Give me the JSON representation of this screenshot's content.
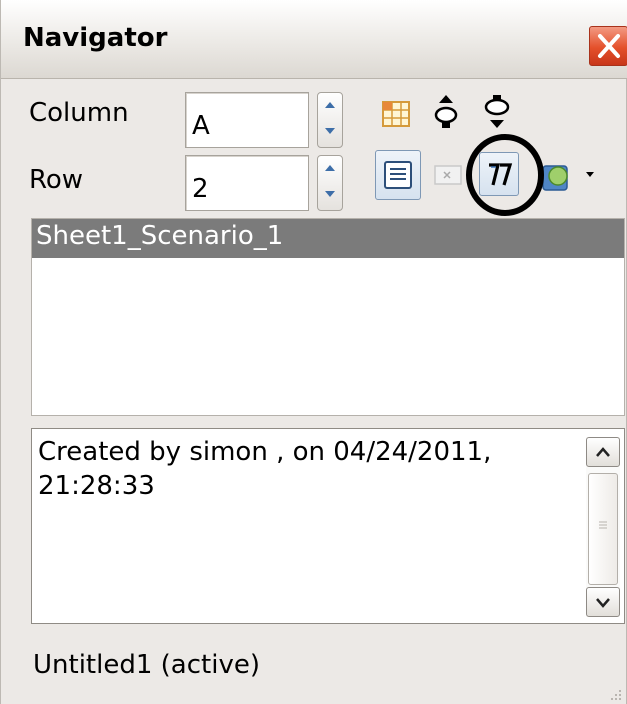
{
  "window": {
    "title": "Navigator"
  },
  "controls": {
    "column_label": "Column",
    "column_value": "A",
    "row_label": "Row",
    "row_value": "2"
  },
  "toolbar": {
    "icons": [
      "data-range-icon",
      "start-icon",
      "end-icon",
      "contents-icon",
      "toggle-icon",
      "scenarios-icon",
      "drag-mode-icon",
      "dropdown-arrow-icon"
    ],
    "highlighted": "scenarios-icon"
  },
  "scenario_list": {
    "items": [
      "Sheet1_Scenario_1"
    ],
    "selected": "Sheet1_Scenario_1"
  },
  "comment": {
    "text": "Created by simon , on 04/24/2011,\n21:28:33"
  },
  "status": {
    "document": "Untitled1 (active)"
  }
}
